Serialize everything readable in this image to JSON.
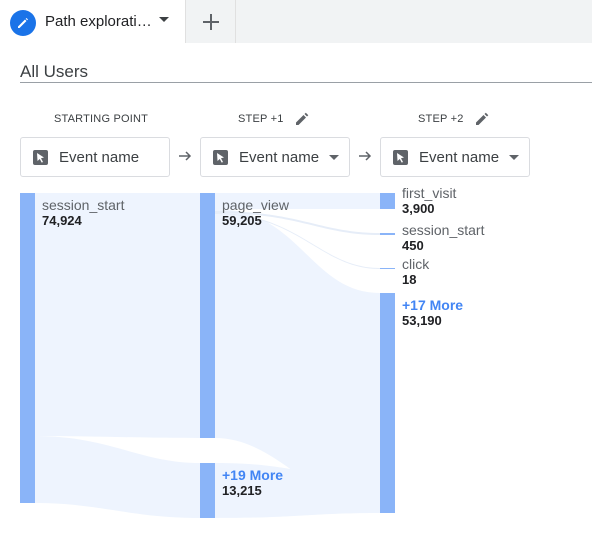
{
  "tab": {
    "title": "Path explorati…",
    "icon": "pencil-icon"
  },
  "add_tab": {
    "icon": "plus-icon"
  },
  "segment": "All Users",
  "columns": [
    {
      "heading": "STARTING POINT",
      "dropdown": "Event name",
      "editable": false
    },
    {
      "heading": "STEP +1",
      "dropdown": "Event name",
      "editable": true
    },
    {
      "heading": "STEP +2",
      "dropdown": "Event name",
      "editable": true
    }
  ],
  "nodes": {
    "start": [
      {
        "name": "session_start",
        "value": "74,924"
      }
    ],
    "step1": [
      {
        "name": "page_view",
        "value": "59,205"
      },
      {
        "name": "+19 More",
        "value": "13,215"
      }
    ],
    "step2": [
      {
        "name": "first_visit",
        "value": "3,900"
      },
      {
        "name": "session_start",
        "value": "450"
      },
      {
        "name": "click",
        "value": "18"
      },
      {
        "name": "+17 More",
        "value": "53,190"
      }
    ]
  },
  "colors": {
    "accent": "#1a73e8",
    "bar": "#8ab4f8",
    "flow": "#eef4fe",
    "more": "#4285f4"
  }
}
